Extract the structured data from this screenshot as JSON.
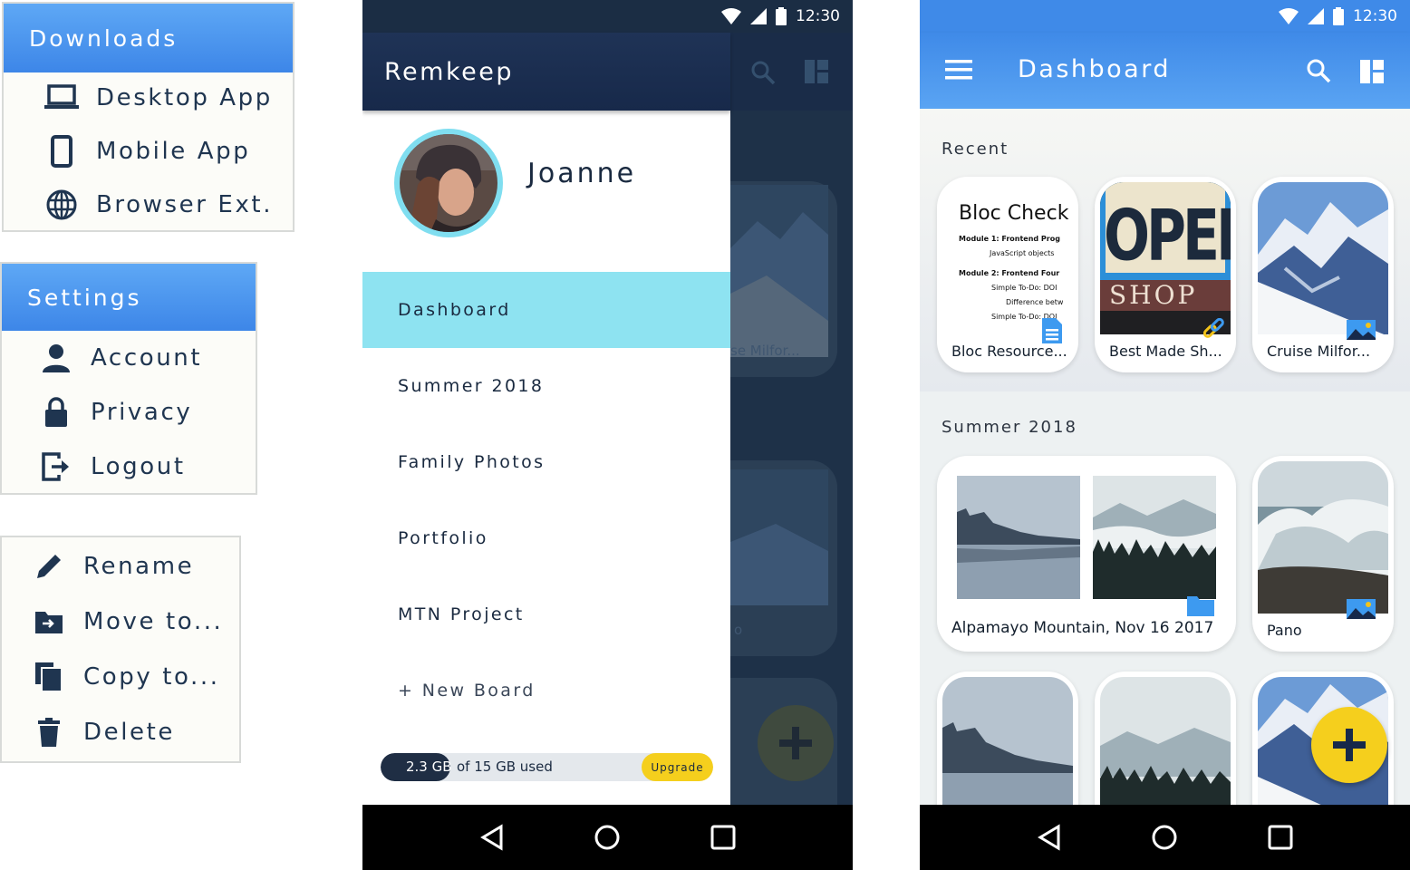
{
  "menus": {
    "downloads": {
      "title": "Downloads",
      "items": [
        {
          "label": "Desktop App",
          "icon": "laptop-icon"
        },
        {
          "label": "Mobile App",
          "icon": "phone-icon"
        },
        {
          "label": "Browser Ext.",
          "icon": "globe-icon"
        }
      ]
    },
    "settings": {
      "title": "Settings",
      "items": [
        {
          "label": "Account",
          "icon": "person-icon"
        },
        {
          "label": "Privacy",
          "icon": "lock-icon"
        },
        {
          "label": "Logout",
          "icon": "logout-icon"
        }
      ]
    },
    "actions": {
      "items": [
        {
          "label": "Rename",
          "icon": "pencil-icon"
        },
        {
          "label": "Move to...",
          "icon": "move-folder-icon"
        },
        {
          "label": "Copy to...",
          "icon": "copy-icon"
        },
        {
          "label": "Delete",
          "icon": "trash-icon"
        }
      ]
    }
  },
  "status_bar": {
    "time": "12:30"
  },
  "drawer": {
    "app_name": "Remkeep",
    "user_name": "Joanne",
    "items": [
      {
        "label": "Dashboard",
        "active": true
      },
      {
        "label": "Summer 2018"
      },
      {
        "label": "Family Photos"
      },
      {
        "label": "Portfolio"
      },
      {
        "label": "MTN Project"
      },
      {
        "label": "+ New Board"
      }
    ],
    "storage": {
      "used": "2.3 GB",
      "text": "of 15 GB used",
      "upgrade": "Upgrade",
      "fraction": 0.153
    },
    "background_captions": [
      "se Milfor...",
      "o"
    ]
  },
  "dashboard": {
    "title": "Dashboard",
    "recent_label": "Recent",
    "recent": [
      {
        "caption": "Bloc Resource...",
        "type": "document",
        "doc_title": "Bloc Check",
        "doc_lines": [
          "Module 1: Frontend Prog",
          "JavaScript objects",
          "Module 2: Frontend Four",
          "Simple To-Do: DOI",
          "Difference betw",
          "Simple To-Do: DOI"
        ]
      },
      {
        "caption": "Best Made Sh...",
        "type": "link",
        "sign_text_1": "OPEN",
        "sign_text_2": "SHOP"
      },
      {
        "caption": "Cruise Milfor...",
        "type": "image"
      }
    ],
    "summer_label": "Summer 2018",
    "summer": [
      {
        "caption": "Alpamayo Mountain, Nov 16 2017",
        "type": "folder"
      },
      {
        "caption": "Pano",
        "type": "image"
      }
    ]
  },
  "colors": {
    "accent_blue": "#3d86e8",
    "drawer_active": "#8ee3f1",
    "fab_yellow": "#f5cf1d",
    "navy": "#1f3356"
  }
}
